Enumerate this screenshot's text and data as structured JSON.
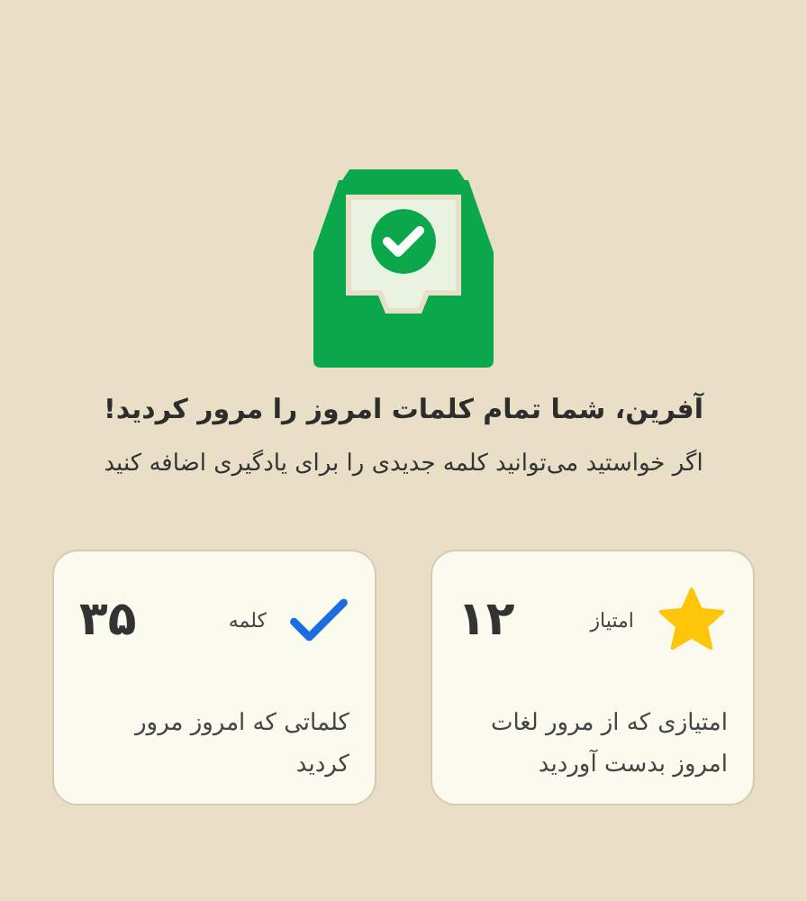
{
  "title": "آفرین، شما تمام کلمات امروز را مرور کردید!",
  "subtitle": "اگر خواستید می‌توانید کلمه جدیدی را برای یادگیری اضافه کنید",
  "stats": [
    {
      "kind": "star",
      "label": "امتیاز",
      "value": "۱۲",
      "description": "امتیازی که از مرور لغات امروز بدست آوردید"
    },
    {
      "kind": "check",
      "label": "کلمه",
      "value": "۳۵",
      "description": "کلماتی که امروز مرور کردید"
    }
  ]
}
